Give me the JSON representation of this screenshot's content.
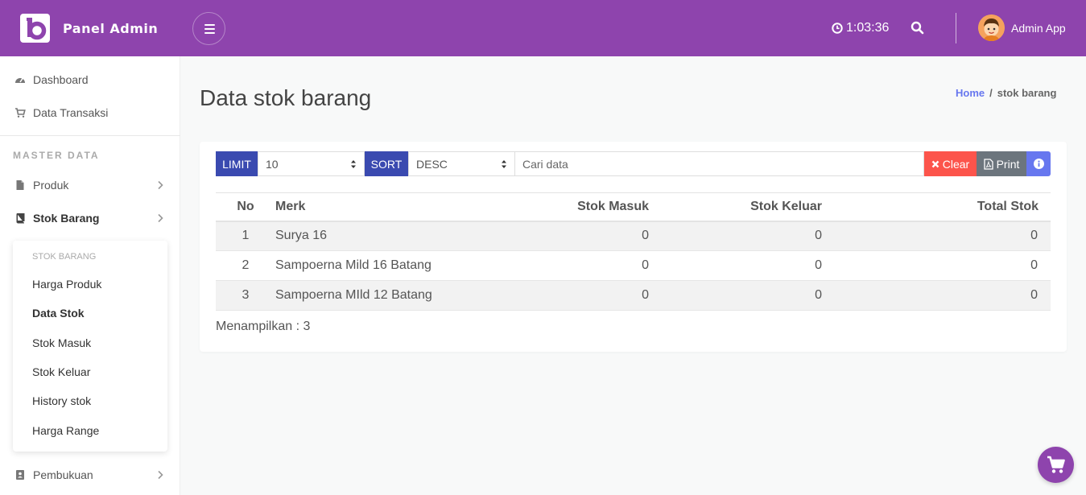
{
  "header": {
    "brand": "Panel Admin",
    "clock": "1:03:36",
    "user_name": "Admin App"
  },
  "sidebar": {
    "items_top": [
      {
        "label": "Dashboard",
        "icon": "dashboard-icon"
      },
      {
        "label": "Data Transaksi",
        "icon": "cart-icon"
      }
    ],
    "section_header": "MASTER DATA",
    "items_master": [
      {
        "label": "Produk",
        "icon": "file-icon"
      },
      {
        "label": "Stok Barang",
        "icon": "book-icon"
      }
    ],
    "submenu_title": "STOK BARANG",
    "submenu": [
      "Harga Produk",
      "Data Stok",
      "Stok Masuk",
      "Stok Keluar",
      "History stok",
      "Harga Range"
    ],
    "submenu_active": "Data Stok",
    "item_bottom": {
      "label": "Pembukuan",
      "icon": "address-book-icon"
    }
  },
  "page": {
    "title": "Data stok barang",
    "breadcrumb": {
      "home": "Home",
      "sep": "/",
      "current": "stok barang"
    }
  },
  "toolbar": {
    "limit_label": "LIMIT",
    "limit_value": "10",
    "sort_label": "SORT",
    "sort_value": "DESC",
    "search_placeholder": "Cari data",
    "clear_label": "Clear",
    "print_label": "Print"
  },
  "table": {
    "columns": [
      "No",
      "Merk",
      "Stok Masuk",
      "Stok Keluar",
      "Total Stok"
    ],
    "rows": [
      [
        "1",
        "Surya 16",
        "0",
        "0",
        "0"
      ],
      [
        "2",
        "Sampoerna Mild 16 Batang",
        "0",
        "0",
        "0"
      ],
      [
        "3",
        "Sampoerna MIld 12 Batang",
        "0",
        "0",
        "0"
      ]
    ]
  },
  "footer": {
    "showing": "Menampilkan : 3"
  },
  "colors": {
    "primary": "#8e44ad",
    "label_blue": "#3a4ab0",
    "clear_red": "#fc544b",
    "print_gray": "#6c757d",
    "info_blue": "#6777ef"
  }
}
